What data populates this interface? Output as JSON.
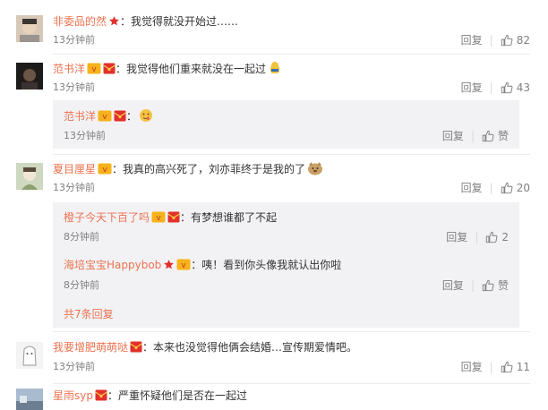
{
  "labels": {
    "reply": "回复",
    "like_text": "赞"
  },
  "comments": [
    {
      "user": "非委品的然",
      "text": "：我觉得就没开始过……",
      "time": "13分钟前",
      "likes": "82"
    },
    {
      "user": "范书洋",
      "text": "：我觉得他们重来就没在一起过",
      "time": "13分钟前",
      "likes": "43",
      "replies": [
        {
          "user": "范书洋",
          "text": "：",
          "time": "13分钟前"
        }
      ]
    },
    {
      "user": "夏目厘星",
      "text": "：我真的高兴死了，刘亦菲终于是我的了",
      "time": "13分钟前",
      "likes": "20",
      "replies": [
        {
          "user": "橙子今天下百了吗",
          "text": "：有梦想谁都了不起",
          "time": "8分钟前",
          "likes": "2"
        },
        {
          "user": "海培宝宝Happybob",
          "text": "：咦！看到你头像我就认出你啦",
          "time": "8分钟前"
        }
      ],
      "more": "共7条回复"
    },
    {
      "user": "我要增肥萌萌哒",
      "text": "：本来也没觉得他俩会结婚…宣传期爱情吧。",
      "time": "13分钟前",
      "likes": "11"
    },
    {
      "user": "星雨syp",
      "text": "：严重怀疑他们是否在一起过"
    }
  ],
  "colors": {
    "username": "#eb7350",
    "subbox_bg": "#f2f2f5",
    "meta": "#808080"
  },
  "icons": [
    "thumb-up-icon",
    "red-star-icon",
    "vip-badge-icon",
    "red-envelope-icon",
    "emoji-icon"
  ]
}
